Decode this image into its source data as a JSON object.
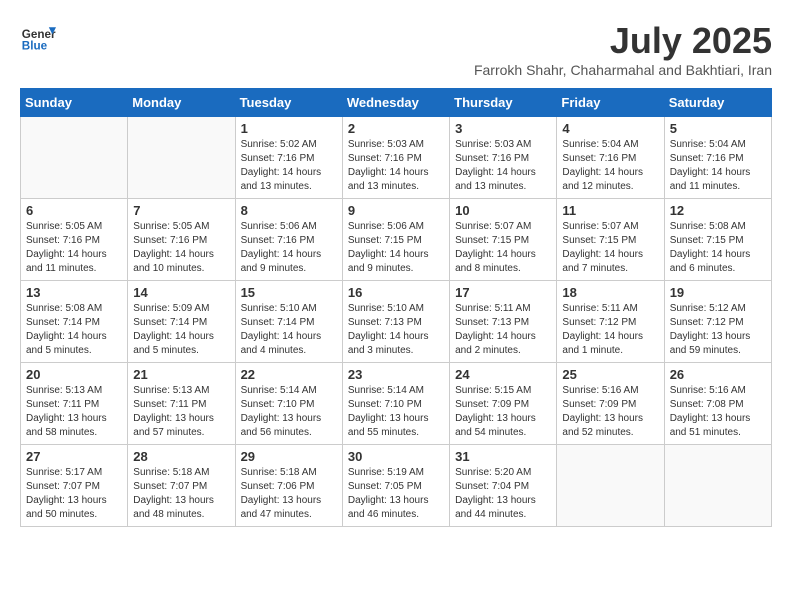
{
  "logo": {
    "line1": "General",
    "line2": "Blue"
  },
  "title": "July 2025",
  "subtitle": "Farrokh Shahr, Chaharmahal and Bakhtiari, Iran",
  "days_header": [
    "Sunday",
    "Monday",
    "Tuesday",
    "Wednesday",
    "Thursday",
    "Friday",
    "Saturday"
  ],
  "weeks": [
    [
      {
        "day": "",
        "info": ""
      },
      {
        "day": "",
        "info": ""
      },
      {
        "day": "1",
        "info": "Sunrise: 5:02 AM\nSunset: 7:16 PM\nDaylight: 14 hours\nand 13 minutes."
      },
      {
        "day": "2",
        "info": "Sunrise: 5:03 AM\nSunset: 7:16 PM\nDaylight: 14 hours\nand 13 minutes."
      },
      {
        "day": "3",
        "info": "Sunrise: 5:03 AM\nSunset: 7:16 PM\nDaylight: 14 hours\nand 13 minutes."
      },
      {
        "day": "4",
        "info": "Sunrise: 5:04 AM\nSunset: 7:16 PM\nDaylight: 14 hours\nand 12 minutes."
      },
      {
        "day": "5",
        "info": "Sunrise: 5:04 AM\nSunset: 7:16 PM\nDaylight: 14 hours\nand 11 minutes."
      }
    ],
    [
      {
        "day": "6",
        "info": "Sunrise: 5:05 AM\nSunset: 7:16 PM\nDaylight: 14 hours\nand 11 minutes."
      },
      {
        "day": "7",
        "info": "Sunrise: 5:05 AM\nSunset: 7:16 PM\nDaylight: 14 hours\nand 10 minutes."
      },
      {
        "day": "8",
        "info": "Sunrise: 5:06 AM\nSunset: 7:16 PM\nDaylight: 14 hours\nand 9 minutes."
      },
      {
        "day": "9",
        "info": "Sunrise: 5:06 AM\nSunset: 7:15 PM\nDaylight: 14 hours\nand 9 minutes."
      },
      {
        "day": "10",
        "info": "Sunrise: 5:07 AM\nSunset: 7:15 PM\nDaylight: 14 hours\nand 8 minutes."
      },
      {
        "day": "11",
        "info": "Sunrise: 5:07 AM\nSunset: 7:15 PM\nDaylight: 14 hours\nand 7 minutes."
      },
      {
        "day": "12",
        "info": "Sunrise: 5:08 AM\nSunset: 7:15 PM\nDaylight: 14 hours\nand 6 minutes."
      }
    ],
    [
      {
        "day": "13",
        "info": "Sunrise: 5:08 AM\nSunset: 7:14 PM\nDaylight: 14 hours\nand 5 minutes."
      },
      {
        "day": "14",
        "info": "Sunrise: 5:09 AM\nSunset: 7:14 PM\nDaylight: 14 hours\nand 5 minutes."
      },
      {
        "day": "15",
        "info": "Sunrise: 5:10 AM\nSunset: 7:14 PM\nDaylight: 14 hours\nand 4 minutes."
      },
      {
        "day": "16",
        "info": "Sunrise: 5:10 AM\nSunset: 7:13 PM\nDaylight: 14 hours\nand 3 minutes."
      },
      {
        "day": "17",
        "info": "Sunrise: 5:11 AM\nSunset: 7:13 PM\nDaylight: 14 hours\nand 2 minutes."
      },
      {
        "day": "18",
        "info": "Sunrise: 5:11 AM\nSunset: 7:12 PM\nDaylight: 14 hours\nand 1 minute."
      },
      {
        "day": "19",
        "info": "Sunrise: 5:12 AM\nSunset: 7:12 PM\nDaylight: 13 hours\nand 59 minutes."
      }
    ],
    [
      {
        "day": "20",
        "info": "Sunrise: 5:13 AM\nSunset: 7:11 PM\nDaylight: 13 hours\nand 58 minutes."
      },
      {
        "day": "21",
        "info": "Sunrise: 5:13 AM\nSunset: 7:11 PM\nDaylight: 13 hours\nand 57 minutes."
      },
      {
        "day": "22",
        "info": "Sunrise: 5:14 AM\nSunset: 7:10 PM\nDaylight: 13 hours\nand 56 minutes."
      },
      {
        "day": "23",
        "info": "Sunrise: 5:14 AM\nSunset: 7:10 PM\nDaylight: 13 hours\nand 55 minutes."
      },
      {
        "day": "24",
        "info": "Sunrise: 5:15 AM\nSunset: 7:09 PM\nDaylight: 13 hours\nand 54 minutes."
      },
      {
        "day": "25",
        "info": "Sunrise: 5:16 AM\nSunset: 7:09 PM\nDaylight: 13 hours\nand 52 minutes."
      },
      {
        "day": "26",
        "info": "Sunrise: 5:16 AM\nSunset: 7:08 PM\nDaylight: 13 hours\nand 51 minutes."
      }
    ],
    [
      {
        "day": "27",
        "info": "Sunrise: 5:17 AM\nSunset: 7:07 PM\nDaylight: 13 hours\nand 50 minutes."
      },
      {
        "day": "28",
        "info": "Sunrise: 5:18 AM\nSunset: 7:07 PM\nDaylight: 13 hours\nand 48 minutes."
      },
      {
        "day": "29",
        "info": "Sunrise: 5:18 AM\nSunset: 7:06 PM\nDaylight: 13 hours\nand 47 minutes."
      },
      {
        "day": "30",
        "info": "Sunrise: 5:19 AM\nSunset: 7:05 PM\nDaylight: 13 hours\nand 46 minutes."
      },
      {
        "day": "31",
        "info": "Sunrise: 5:20 AM\nSunset: 7:04 PM\nDaylight: 13 hours\nand 44 minutes."
      },
      {
        "day": "",
        "info": ""
      },
      {
        "day": "",
        "info": ""
      }
    ]
  ]
}
